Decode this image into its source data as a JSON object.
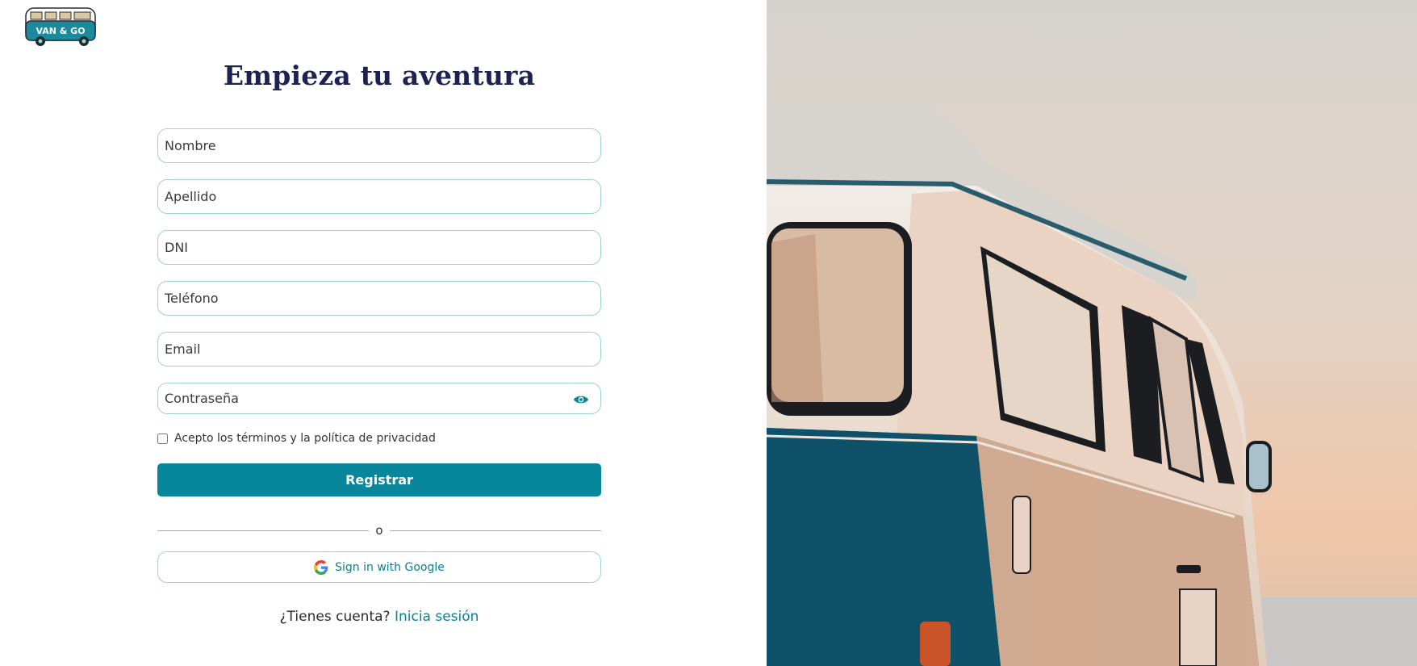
{
  "brand": {
    "logo_text": "VAN & GO",
    "logo_color": "#1a8a9c"
  },
  "page": {
    "title": "Empieza tu aventura"
  },
  "form": {
    "fields": [
      {
        "placeholder": "Nombre",
        "value": ""
      },
      {
        "placeholder": "Apellido",
        "value": ""
      },
      {
        "placeholder": "DNI",
        "value": ""
      },
      {
        "placeholder": "Teléfono",
        "value": ""
      },
      {
        "placeholder": "Email",
        "value": ""
      },
      {
        "placeholder": "Contraseña",
        "value": ""
      }
    ],
    "terms_label": "Acepto los términos y la política de privacidad",
    "terms_checked": false,
    "register_label": "Registrar",
    "divider_label": "o",
    "google_label": "Sign in with Google",
    "signin_prompt": "¿Tienes cuenta?",
    "signin_link": "Inicia sesión"
  },
  "theme": {
    "accent": "#07869c",
    "title_color": "#1c2350",
    "border": "#9fd2c9"
  },
  "hero": {
    "icon": "camper-van-photo"
  }
}
